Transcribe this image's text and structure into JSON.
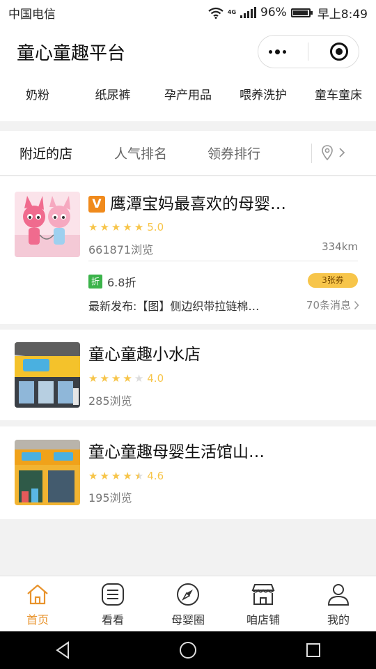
{
  "status": {
    "carrier": "中国电信",
    "battery": "96%",
    "battery_level": 0.96,
    "time": "早上8:49",
    "network": "4G"
  },
  "header": {
    "title": "童心童趣平台"
  },
  "categories": [
    "奶粉",
    "纸尿裤",
    "孕产用品",
    "喂养洗护",
    "童车童床"
  ],
  "tabs": [
    "附近的店",
    "人气排名",
    "领券排行"
  ],
  "shops": [
    {
      "badge": "V",
      "name": "鹰潭宝妈最喜欢的母婴…",
      "stars": 5,
      "rating": "5.0",
      "views": "661871浏览",
      "distance": "334km",
      "discount_icon": "折",
      "discount": "6.8折",
      "coupon": "3张券",
      "latest": "最新发布:【图】侧边织带拉链棉…",
      "messages": "70条消息"
    },
    {
      "name": "童心童趣小水店",
      "stars": 4,
      "rating": "4.0",
      "views": "285浏览"
    },
    {
      "name": "童心童趣母婴生活馆山…",
      "stars": 4.5,
      "rating": "4.6",
      "views": "195浏览"
    }
  ],
  "tabbar": [
    "首页",
    "看看",
    "母婴圈",
    "咱店铺",
    "我的"
  ],
  "colors": {
    "accent": "#e8932c",
    "star": "#f7c54a",
    "vip_badge": "#f08a1c",
    "discount_icon": "#3bb34a"
  },
  "icons": [
    "wifi-icon",
    "signal-icon",
    "battery-icon",
    "more-icon",
    "target-icon",
    "location-pin-icon",
    "chevron-right-icon",
    "home-icon",
    "list-icon",
    "compass-icon",
    "store-icon",
    "user-icon",
    "back-icon",
    "home-circle-icon",
    "recents-icon"
  ]
}
